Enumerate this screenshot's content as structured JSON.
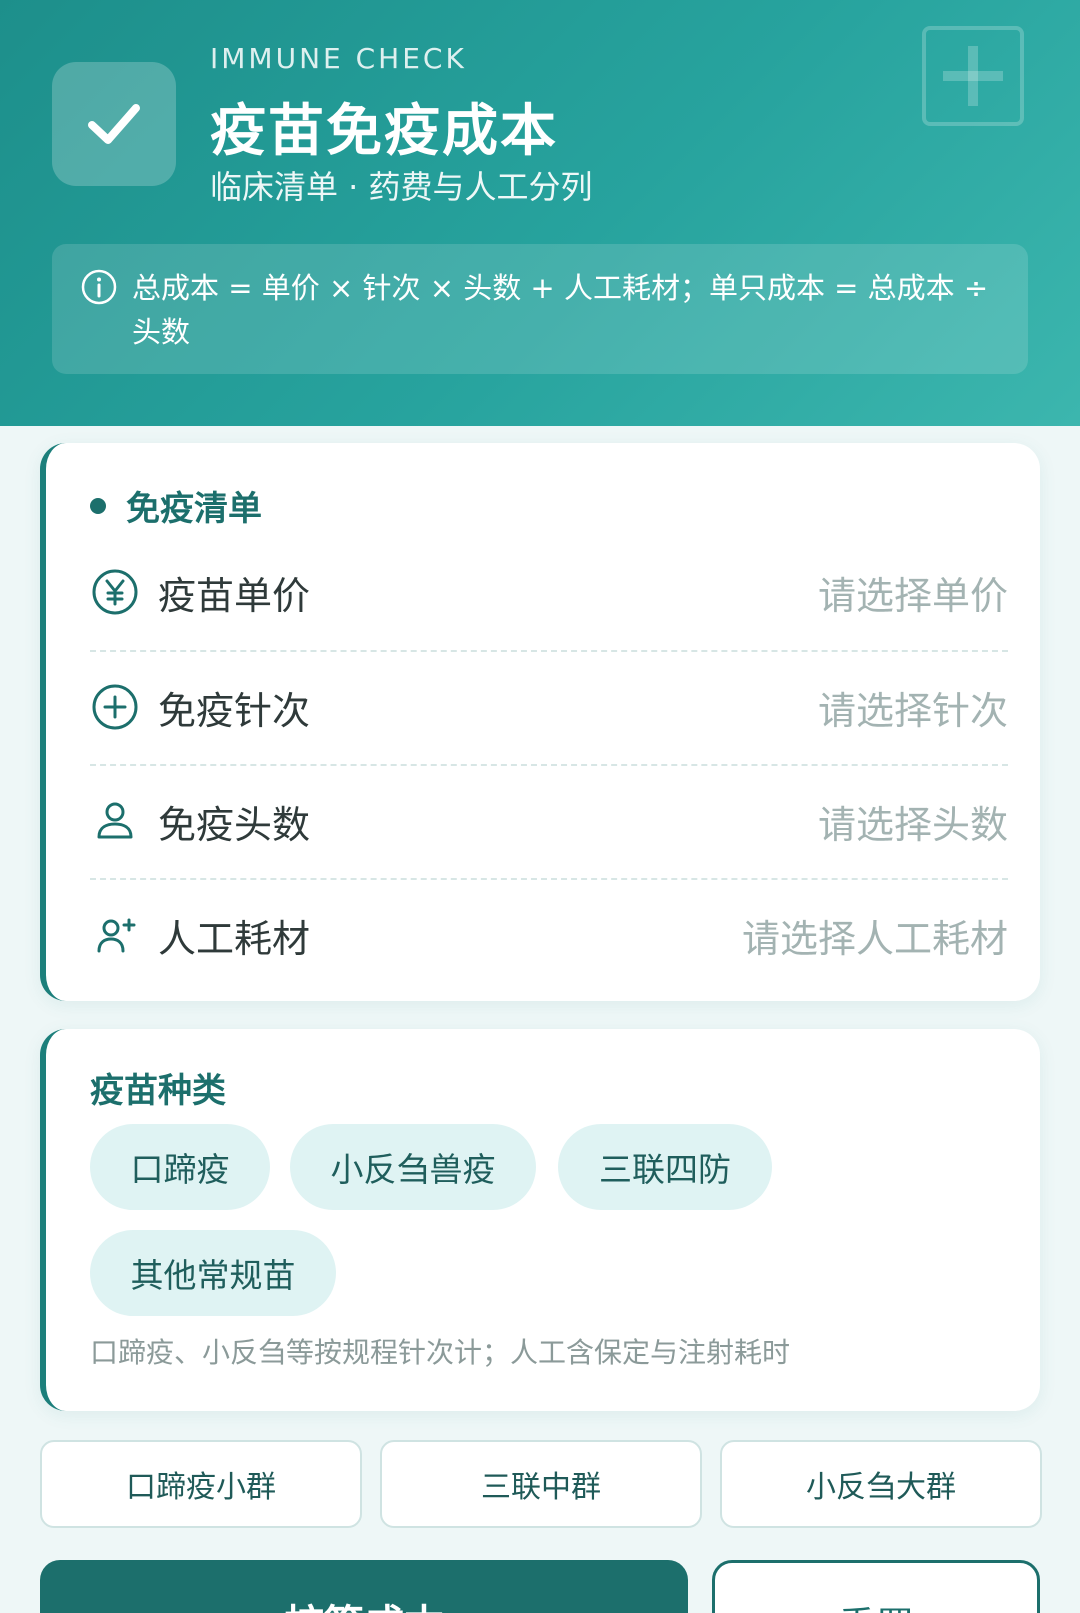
{
  "header": {
    "eyebrow": "IMMUNE CHECK",
    "title": "疫苗免疫成本",
    "subtitle": "临床清单 · 药费与人工分列",
    "logo_icon": "check-icon",
    "decor_icon": "plus-square-icon",
    "formula": "总成本 = 单价 × 针次 × 头数 + 人工耗材；单只成本 = 总成本 ÷ 头数"
  },
  "checklist": {
    "title": "免疫清单",
    "rows": [
      {
        "icon": "yuan-icon",
        "label": "疫苗单价",
        "placeholder": "请选择单价"
      },
      {
        "icon": "plus-circle-icon",
        "label": "免疫针次",
        "placeholder": "请选择针次"
      },
      {
        "icon": "user-icon",
        "label": "免疫头数",
        "placeholder": "请选择头数"
      },
      {
        "icon": "user-add-icon",
        "label": "人工耗材",
        "placeholder": "请选择人工耗材"
      }
    ]
  },
  "vaccine_types": {
    "title": "疫苗种类",
    "options": [
      "口蹄疫",
      "小反刍兽疫",
      "三联四防",
      "其他常规苗"
    ],
    "note": "口蹄疫、小反刍等按规程针次计；人工含保定与注射耗时"
  },
  "presets": [
    "口蹄疫小群",
    "三联中群",
    "小反刍大群"
  ],
  "actions": {
    "primary": "核算成本",
    "secondary": "重置"
  },
  "colors": {
    "brand": "#1c6f6c",
    "header_gradient_start": "#1d8f8b",
    "header_gradient_end": "#3cb6ae",
    "chip_bg": "#dff3f3",
    "placeholder": "#a3b3b2"
  }
}
